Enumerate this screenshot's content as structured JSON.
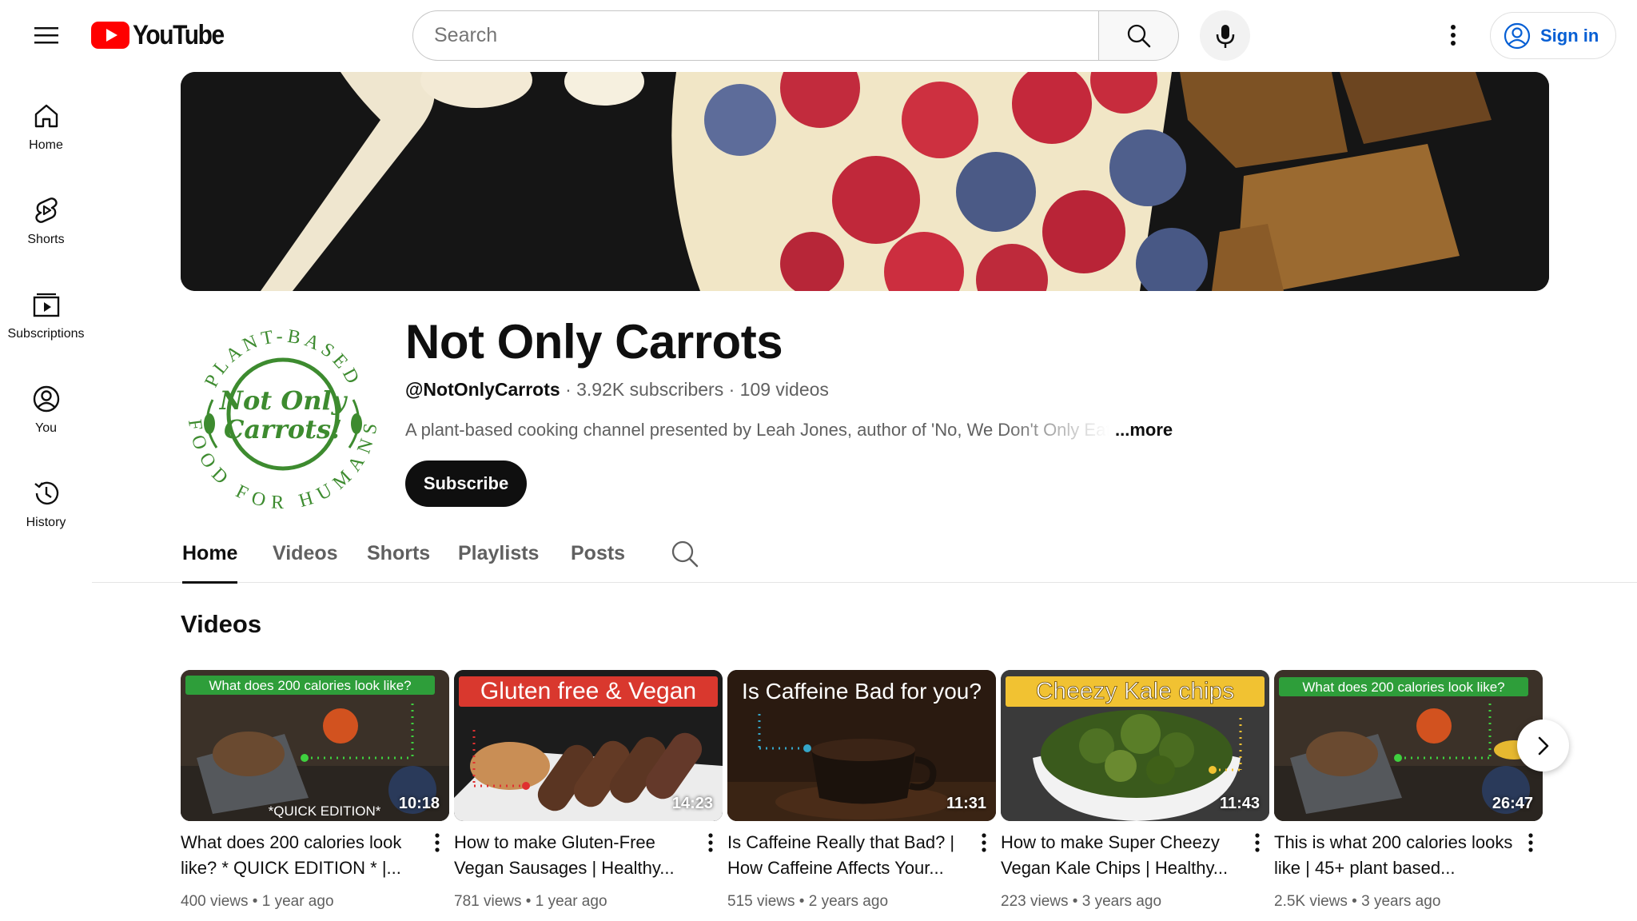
{
  "header": {
    "logo_text": "YouTube",
    "search_placeholder": "Search",
    "sign_in_label": "Sign in"
  },
  "sidenav": {
    "items": [
      {
        "label": "Home",
        "icon": "home-icon"
      },
      {
        "label": "Shorts",
        "icon": "shorts-icon"
      },
      {
        "label": "Subscriptions",
        "icon": "subscriptions-icon"
      },
      {
        "label": "You",
        "icon": "you-icon"
      },
      {
        "label": "History",
        "icon": "history-icon"
      }
    ]
  },
  "channel": {
    "name": "Not Only Carrots",
    "handle": "@NotOnlyCarrots",
    "subscribers": "3.92K subscribers",
    "video_count": "109 videos",
    "separator": "·",
    "description": "A plant-based cooking channel presented by Leah Jones, author of 'No, We Don't Only Eat",
    "more_label": "...more",
    "subscribe_label": "Subscribe",
    "avatar_top_text": "PLANT-BASED",
    "avatar_bottom_text": "FOOD FOR HUMANS",
    "avatar_center_line1": "Not Only",
    "avatar_center_line2": "Carrots!"
  },
  "tabs": [
    {
      "label": "Home",
      "active": true
    },
    {
      "label": "Videos",
      "active": false
    },
    {
      "label": "Shorts",
      "active": false
    },
    {
      "label": "Playlists",
      "active": false
    },
    {
      "label": "Posts",
      "active": false
    }
  ],
  "shelf": {
    "title": "Videos",
    "videos": [
      {
        "title": "What does 200 calories look like? * QUICK EDITION * |...",
        "duration": "10:18",
        "views": "400 views",
        "age": "1 year ago",
        "thumb_caption": "What does 200 calories look like?",
        "thumb_subcaption": "*QUICK EDITION*"
      },
      {
        "title": "How to make Gluten-Free Vegan Sausages | Healthy...",
        "duration": "14:23",
        "views": "781 views",
        "age": "1 year ago",
        "thumb_caption": "Gluten free & Vegan"
      },
      {
        "title": "Is Caffeine Really that Bad? | How Caffeine Affects Your...",
        "duration": "11:31",
        "views": "515 views",
        "age": "2 years ago",
        "thumb_caption": "Is Caffeine Bad for you?"
      },
      {
        "title": "How to make Super Cheezy Vegan Kale Chips | Healthy...",
        "duration": "11:43",
        "views": "223 views",
        "age": "3 years ago",
        "thumb_caption": "Cheezy Kale chips"
      },
      {
        "title": "This is what 200 calories looks like | 45+ plant based...",
        "duration": "26:47",
        "views": "2.5K views",
        "age": "3 years ago",
        "thumb_caption": "What does 200 calories look like?"
      }
    ],
    "meta_separator": "•"
  },
  "colors": {
    "youtube_red": "#ff0000",
    "link_blue": "#065fd4",
    "avatar_green": "#3d8b2f",
    "caption_green": "#2e9e3a"
  }
}
